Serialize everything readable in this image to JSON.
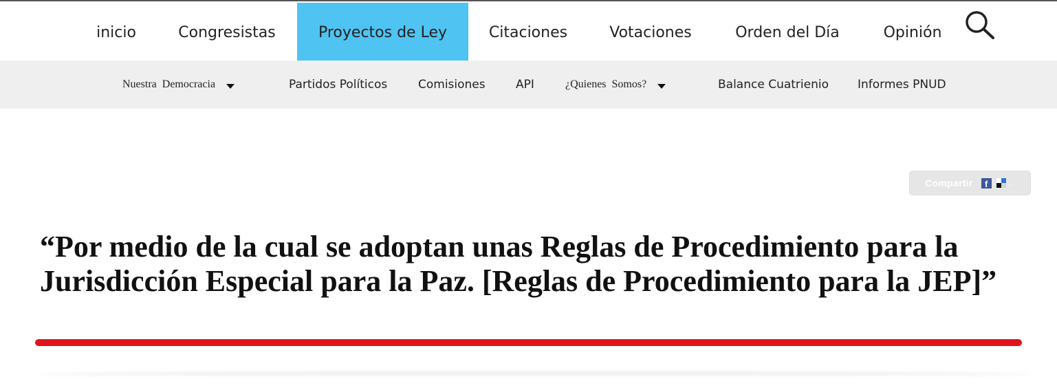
{
  "top_nav": {
    "items": [
      {
        "label": "inicio"
      },
      {
        "label": "Congresistas"
      },
      {
        "label": "Proyectos de Ley",
        "active": true
      },
      {
        "label": "Citaciones"
      },
      {
        "label": "Votaciones"
      },
      {
        "label": "Orden del Día"
      },
      {
        "label": "Opinión"
      }
    ],
    "search_icon": "search-icon",
    "active_color": "#4fc3f2"
  },
  "sub_nav": {
    "items": [
      {
        "label": "Nuestra Democracia",
        "dropdown": true
      },
      {
        "label": "Partidos Políticos"
      },
      {
        "label": "Comisiones"
      },
      {
        "label": "API"
      },
      {
        "label": "¿Quienes Somos?",
        "dropdown": true
      },
      {
        "label": "Balance Cuatrienio"
      },
      {
        "label": "Informes PNUD"
      }
    ]
  },
  "share": {
    "label": "Compartir",
    "more": "...",
    "icons": [
      "facebook-icon",
      "delicious-icon"
    ]
  },
  "title": "“Por medio de la cual se adoptan unas Reglas de Procedimiento para la Jurisdicción Especial para la Paz. [Reglas de Procedimiento para la JEP]”",
  "colors": {
    "accent_underline": "#e0141c",
    "subnav_background": "#efefef"
  }
}
